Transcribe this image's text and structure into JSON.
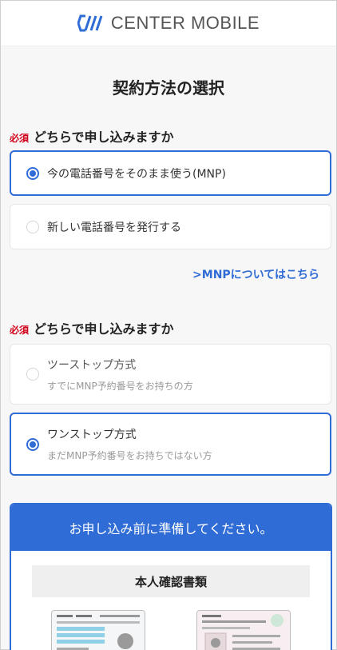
{
  "header": {
    "logo_text": "CENTER MOBILE",
    "logo_icon": "center-mobile-logo-mark",
    "brand_color": "#2f6cd6"
  },
  "page_title": "契約方法の選択",
  "question1": {
    "required": "必須",
    "text": "どちらで申し込みますか",
    "options": [
      {
        "label": "今の電話番号をそのまま使う(MNP)",
        "selected": true
      },
      {
        "label": "新しい電話番号を発行する",
        "selected": false
      }
    ]
  },
  "mnp_link": ">MNPについてはこちら",
  "question2": {
    "required": "必須",
    "text": "どちらで申し込みますか",
    "options": [
      {
        "label": "ツーストップ方式",
        "sub": "すでにMNP予約番号をお持ちの方",
        "selected": false
      },
      {
        "label": "ワンストップ方式",
        "sub": "まだMNP予約番号をお持ちではない方",
        "selected": true
      }
    ]
  },
  "prepare": {
    "header": "お申し込み前に準備してください。",
    "section_title": "本人確認書類"
  },
  "colors": {
    "accent": "#2f6cd6",
    "required": "#d0021b"
  }
}
